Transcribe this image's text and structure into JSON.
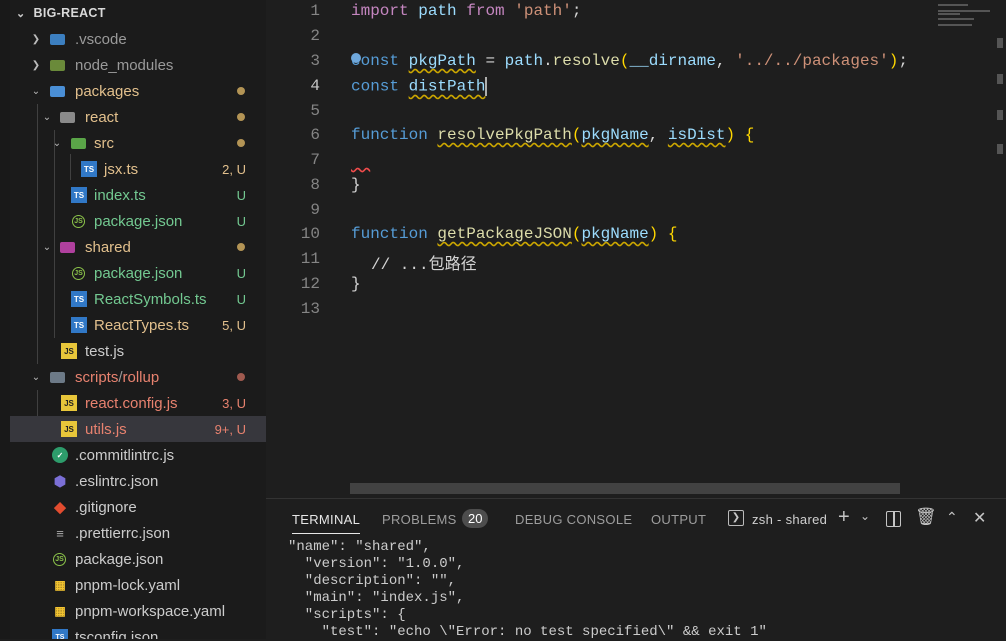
{
  "explorer": {
    "title": "BIG-REACT",
    "items": [
      {
        "name": ".vscode",
        "badge": "",
        "color": "#9a9a9a"
      },
      {
        "name": "node_modules",
        "badge": "",
        "color": "#9a9a9a"
      },
      {
        "name": "packages",
        "badge": "",
        "color": "#e2c08d"
      },
      {
        "name": "react",
        "badge": "",
        "color": "#e2c08d"
      },
      {
        "name": "src",
        "badge": "",
        "color": "#e2c08d"
      },
      {
        "name": "jsx.ts",
        "badge": "2, U",
        "color": "#e2c08d"
      },
      {
        "name": "index.ts",
        "badge": "U",
        "color": "#73c991"
      },
      {
        "name": "package.json",
        "badge": "U",
        "color": "#73c991"
      },
      {
        "name": "shared",
        "badge": "",
        "color": "#e2c08d"
      },
      {
        "name": "package.json",
        "badge": "U",
        "color": "#73c991"
      },
      {
        "name": "ReactSymbols.ts",
        "badge": "U",
        "color": "#73c991"
      },
      {
        "name": "ReactTypes.ts",
        "badge": "5, U",
        "color": "#e2c08d"
      },
      {
        "name": "test.js",
        "badge": "",
        "color": "#cccccc"
      },
      {
        "name": "scripts",
        "name2": "rollup",
        "badge": "",
        "color": "#e8826f"
      },
      {
        "name": "react.config.js",
        "badge": "3, U",
        "color": "#e8826f"
      },
      {
        "name": "utils.js",
        "badge": "9+, U",
        "color": "#e8826f"
      },
      {
        "name": ".commitlintrc.js",
        "badge": "",
        "color": "#cccccc"
      },
      {
        "name": ".eslintrc.json",
        "badge": "",
        "color": "#cccccc"
      },
      {
        "name": ".gitignore",
        "badge": "",
        "color": "#cccccc"
      },
      {
        "name": ".prettierrc.json",
        "badge": "",
        "color": "#cccccc"
      },
      {
        "name": "package.json",
        "badge": "",
        "color": "#cccccc"
      },
      {
        "name": "pnpm-lock.yaml",
        "badge": "",
        "color": "#cccccc"
      },
      {
        "name": "pnpm-workspace.yaml",
        "badge": "",
        "color": "#cccccc"
      },
      {
        "name": "tsconfig.json",
        "badge": "",
        "color": "#cccccc"
      }
    ],
    "folder_separator": "/"
  },
  "editor": {
    "line_numbers": [
      "1",
      "2",
      "3",
      "4",
      "5",
      "6",
      "7",
      "8",
      "9",
      "10",
      "11",
      "12",
      "13"
    ],
    "current_line": "4",
    "code": {
      "l1": {
        "kw": "import",
        "id": "path",
        "from": "from",
        "str": "'path'",
        "end": ";"
      },
      "l3": {
        "kw": "const",
        "id": "pkgPath",
        "eq": " = ",
        "obj": "path",
        "dot": ".",
        "fn": "resolve",
        "op": "(",
        "arg": "__dirname",
        "comma": ", ",
        "str": "'../../packages'",
        "cp": ")",
        "end": ";"
      },
      "l4": {
        "kw": "const",
        "id": "distPath"
      },
      "l6": {
        "kw": "function",
        "fn": "resolvePkgPath",
        "op": "(",
        "p1": "pkgName",
        "comma": ", ",
        "p2": "isDist",
        "cp": ")",
        "brace": "{"
      },
      "l8": {
        "brace": "}"
      },
      "l10": {
        "kw": "function",
        "fn": "getPackageJSON",
        "op": "(",
        "p1": "pkgName",
        "cp": ")",
        "brace": "{"
      },
      "l11": {
        "comment": "// ...包路径"
      },
      "l12": {
        "brace": "}"
      }
    }
  },
  "panel": {
    "tabs": [
      "TERMINAL",
      "PROBLEMS",
      "DEBUG CONSOLE",
      "OUTPUT"
    ],
    "problems_count": "20",
    "shell": "zsh - shared",
    "terminal_lines": [
      "\"name\": \"shared\",",
      "  \"version\": \"1.0.0\",",
      "  \"description\": \"\",",
      "  \"main\": \"index.js\",",
      "  \"scripts\": {",
      "    \"test\": \"echo \\\"Error: no test specified\\\" && exit 1\""
    ]
  }
}
